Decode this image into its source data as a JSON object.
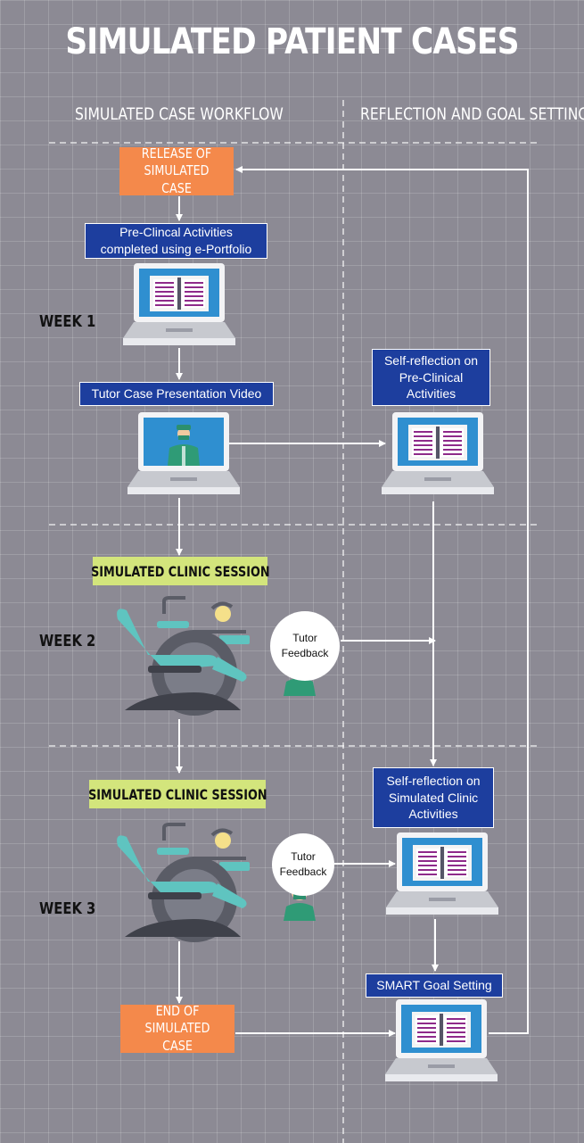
{
  "title": "SIMULATED PATIENT CASES",
  "columns": {
    "left": "SIMULATED CASE WORKFLOW",
    "right": "REFLECTION AND GOAL SETTING"
  },
  "weeks": [
    "WEEK 1",
    "WEEK 2",
    "WEEK 3"
  ],
  "nodes": {
    "release": "RELEASE OF\nSIMULATED CASE",
    "preclinical": "Pre-Clincal Activities\ncompleted using e-Portfolio",
    "tutor_video": "Tutor Case Presentation Video",
    "self_reflection_preclinical": "Self-reflection on\nPre-Clinical\nActivities",
    "clinic_session_1": "SIMULATED CLINIC SESSION",
    "tutor_feedback_1": "Tutor\nFeedback",
    "clinic_session_2": "SIMULATED CLINIC SESSION",
    "self_reflection_clinic": "Self-reflection on\nSimulated Clinic\nActivities",
    "tutor_feedback_2": "Tutor\nFeedback",
    "smart_goal": "SMART Goal Setting",
    "end": "END OF SIMULATED\nCASE"
  },
  "colors": {
    "background": "#8c8a94",
    "orange_box": "#f4894b",
    "blue_box": "#1d3e9e",
    "green_label": "#d3e57c",
    "laptop_screen": "#2f8fd0",
    "chair_teal": "#5fc4c0"
  },
  "icons": {
    "laptop_notebook": "laptop-notebook-icon",
    "laptop_video": "laptop-tutor-video-icon",
    "dental_chair": "dental-chair-icon",
    "tutor": "tutor-avatar-icon"
  }
}
